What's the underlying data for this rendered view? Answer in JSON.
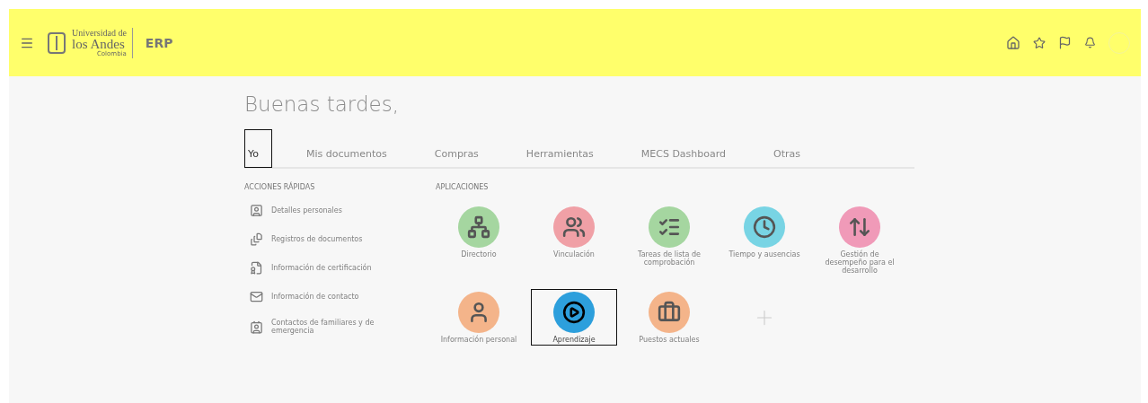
{
  "header": {
    "logo_line1": "Universidad de",
    "logo_line2": "los Andes",
    "logo_line3": "Colombia",
    "app_name": "ERP"
  },
  "greeting": "Buenas tardes,",
  "tabs": [
    {
      "label": "Yo",
      "selected": true
    },
    {
      "label": "Mis documentos",
      "selected": false
    },
    {
      "label": "Compras",
      "selected": false
    },
    {
      "label": "Herramientas",
      "selected": false
    },
    {
      "label": "MECS Dashboard",
      "selected": false
    },
    {
      "label": "Otras",
      "selected": false
    }
  ],
  "quick_actions": {
    "heading": "ACCIONES RÁPIDAS",
    "items": [
      "Detalles personales",
      "Registros de documentos",
      "Información de certificación",
      "Información de contacto",
      "Contactos de familiares y de emergencia"
    ]
  },
  "applications": {
    "heading": "APLICACIONES",
    "items": [
      {
        "label": "Directorio",
        "color": "#a5d6a0",
        "selected": false
      },
      {
        "label": "Vinculación",
        "color": "#f0a0a6",
        "selected": false
      },
      {
        "label": "Tareas de lista de comprobación",
        "color": "#a5d6a0",
        "selected": false
      },
      {
        "label": "Tiempo y ausencias",
        "color": "#78d4e4",
        "selected": false
      },
      {
        "label": "Gestión de desempeño para el desarrollo",
        "color": "#f09ab8",
        "selected": false
      },
      {
        "label": "Información personal",
        "color": "#f4b48a",
        "selected": false
      },
      {
        "label": "Aprendizaje",
        "color": "#2d9fdc",
        "selected": true
      },
      {
        "label": "Puestos actuales",
        "color": "#f4b48a",
        "selected": false
      }
    ]
  }
}
